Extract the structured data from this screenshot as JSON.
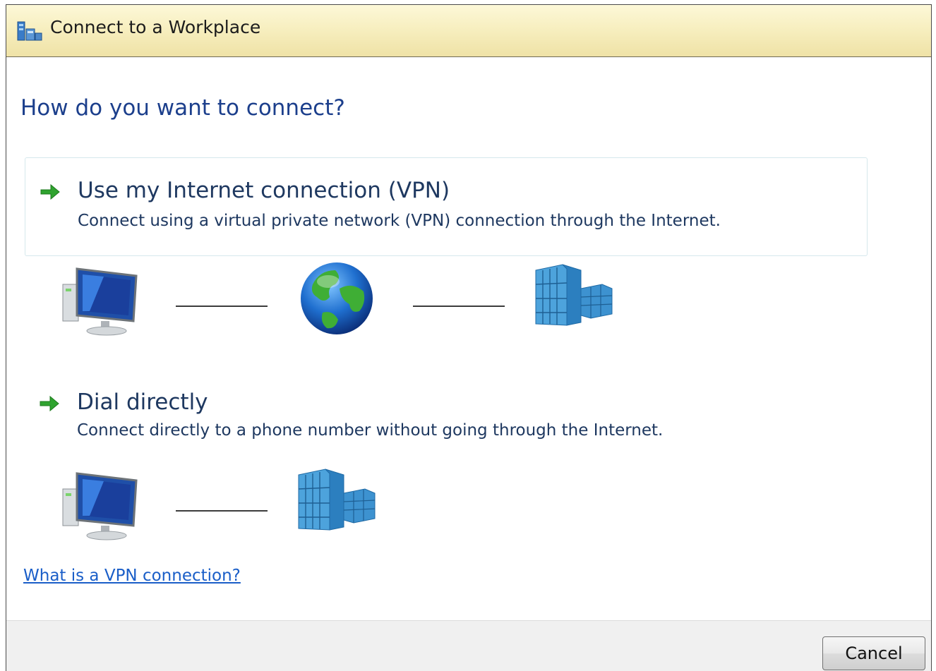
{
  "window": {
    "title": "Connect to a Workplace"
  },
  "heading": "How do you want to connect?",
  "options": [
    {
      "title": "Use my Internet connection (VPN)",
      "description": "Connect using a virtual private network (VPN) connection through the Internet."
    },
    {
      "title": "Dial directly",
      "description": "Connect directly to a phone number without going through the Internet."
    }
  ],
  "icons": {
    "window": "network-connection-icon",
    "option_arrow": "green-arrow-icon",
    "computer": "computer-monitor-icon",
    "internet": "globe-icon",
    "workplace": "office-building-icon"
  },
  "help_link": "What is a VPN connection?",
  "buttons": {
    "cancel": "Cancel"
  },
  "colors": {
    "heading": "#1c3f8c",
    "link": "#1a5ec8",
    "arrow": "#2fa32f",
    "titlebar": "#f7efc0"
  }
}
